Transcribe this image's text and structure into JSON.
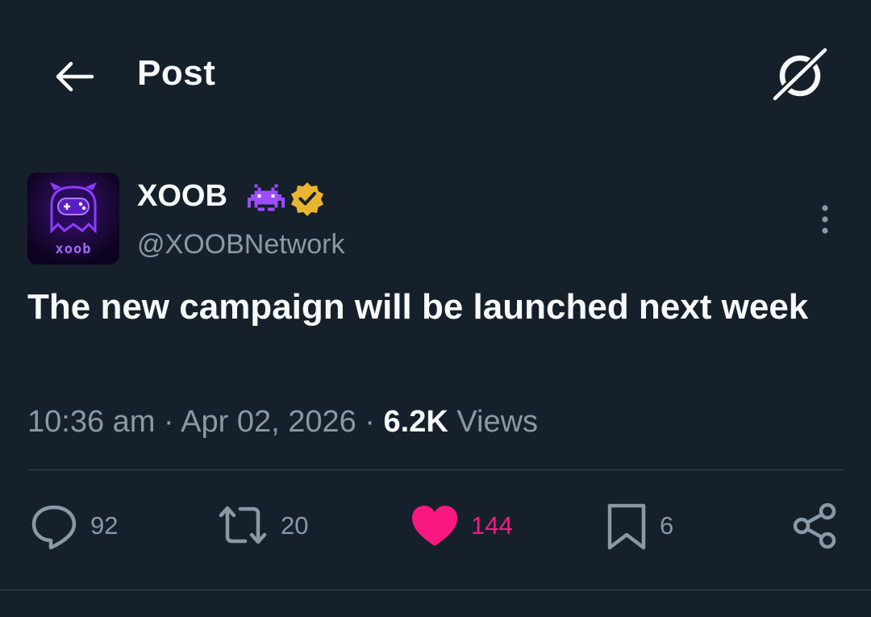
{
  "header": {
    "title": "Post",
    "back_icon": "arrow-left-icon",
    "grok_icon": "grok-icon"
  },
  "author": {
    "name": "XOOB",
    "handle": "@XOOBNetwork",
    "avatar_text": "xoob",
    "name_emoji": "alien-monster-icon",
    "verified": true,
    "verified_color": "#e8b530"
  },
  "post": {
    "text": "The new campaign will be launched next week"
  },
  "meta": {
    "time": "10:36 am",
    "separator": " · ",
    "date": "Apr 02, 2026",
    "views_count": "6.2K",
    "views_label": "Views"
  },
  "actions": {
    "reply": {
      "icon": "reply-icon",
      "count": "92"
    },
    "repost": {
      "icon": "repost-icon",
      "count": "20"
    },
    "like": {
      "icon": "heart-icon",
      "count": "144",
      "active": true,
      "color": "#f91880"
    },
    "bookmark": {
      "icon": "bookmark-icon",
      "count": "6"
    },
    "share": {
      "icon": "share-icon"
    }
  },
  "colors": {
    "background": "#15202b",
    "primary_text": "#f7f9f9",
    "secondary_text": "#8b98a5",
    "divider": "#38444d"
  }
}
